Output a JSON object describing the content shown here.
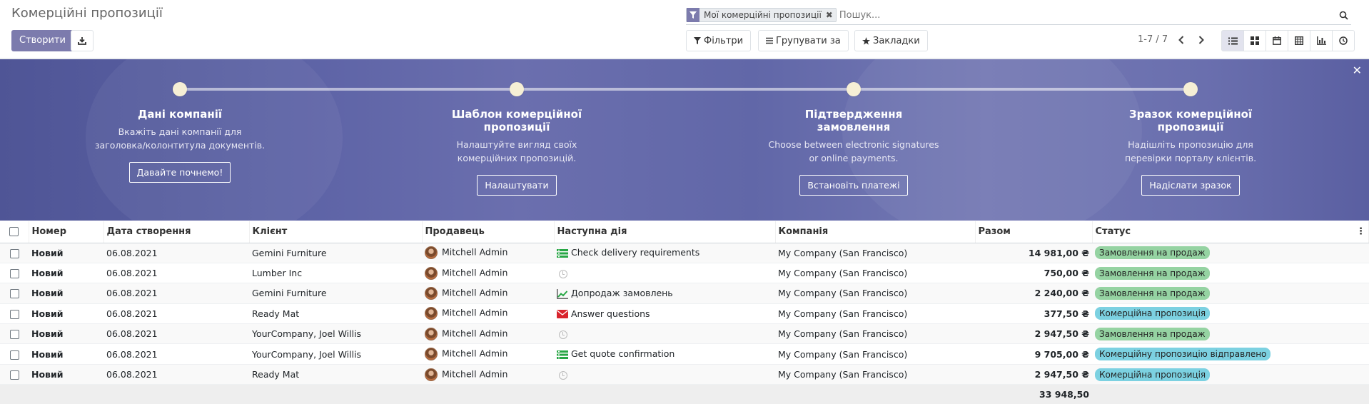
{
  "page": {
    "title": "Комерційні пропозиції"
  },
  "toolbar": {
    "create_label": "Створити",
    "download_icon": "download-icon"
  },
  "search": {
    "facet_label": "Мої комерційні пропозиції",
    "placeholder": "Пошук..."
  },
  "filters": {
    "filters_label": "Фільтри",
    "group_by_label": "Групувати за",
    "favorites_label": "Закладки"
  },
  "pager": {
    "value": "1-7 / 7"
  },
  "views": [
    "list",
    "kanban",
    "calendar",
    "pivot",
    "graph",
    "activity"
  ],
  "banner": {
    "steps": [
      {
        "title": "Дані компанії",
        "desc": "Вкажіть дані компанії для заголовка/колонтитула документів.",
        "button": "Давайте почнемо!"
      },
      {
        "title": "Шаблон комерційної пропозиції",
        "desc": "Налаштуйте вигляд своїх комерційних пропозицій.",
        "button": "Налаштувати"
      },
      {
        "title": "Підтвердження замовлення",
        "desc": "Choose between electronic signatures or online payments.",
        "button": "Встановіть платежі"
      },
      {
        "title": "Зразок комерційної пропозиції",
        "desc": "Надішліть пропозицію для перевірки порталу клієнтів.",
        "button": "Надіслати зразок"
      }
    ]
  },
  "table": {
    "columns": [
      "Номер",
      "Дата створення",
      "Клієнт",
      "Продавець",
      "Наступна дія",
      "Компанія",
      "Разом",
      "Статус"
    ],
    "rows": [
      {
        "number": "Новий",
        "date": "06.08.2021",
        "client": "Gemini Furniture",
        "salesperson": "Mitchell Admin",
        "activity_icon": "todo",
        "activity": "Check delivery requirements",
        "company": "My Company (San Francisco)",
        "total": "14 981,00 ₴",
        "status": "Замовлення на продаж",
        "status_type": "success"
      },
      {
        "number": "Новий",
        "date": "06.08.2021",
        "client": "Lumber Inc",
        "salesperson": "Mitchell Admin",
        "activity_icon": "clock",
        "activity": "",
        "company": "My Company (San Francisco)",
        "total": "750,00 ₴",
        "status": "Замовлення на продаж",
        "status_type": "success"
      },
      {
        "number": "Новий",
        "date": "06.08.2021",
        "client": "Gemini Furniture",
        "salesperson": "Mitchell Admin",
        "activity_icon": "upsell",
        "activity": "Допродаж замовлень",
        "company": "My Company (San Francisco)",
        "total": "2 240,00 ₴",
        "status": "Замовлення на продаж",
        "status_type": "success"
      },
      {
        "number": "Новий",
        "date": "06.08.2021",
        "client": "Ready Mat",
        "salesperson": "Mitchell Admin",
        "activity_icon": "email",
        "activity": "Answer questions",
        "company": "My Company (San Francisco)",
        "total": "377,50 ₴",
        "status": "Комерційна пропозиція",
        "status_type": "info"
      },
      {
        "number": "Новий",
        "date": "06.08.2021",
        "client": "YourCompany, Joel Willis",
        "salesperson": "Mitchell Admin",
        "activity_icon": "clock",
        "activity": "",
        "company": "My Company (San Francisco)",
        "total": "2 947,50 ₴",
        "status": "Замовлення на продаж",
        "status_type": "success"
      },
      {
        "number": "Новий",
        "date": "06.08.2021",
        "client": "YourCompany, Joel Willis",
        "salesperson": "Mitchell Admin",
        "activity_icon": "todo",
        "activity": "Get quote confirmation",
        "company": "My Company (San Francisco)",
        "total": "9 705,00 ₴",
        "status": "Комерційну пропозицію відправлено",
        "status_type": "info"
      },
      {
        "number": "Новий",
        "date": "06.08.2021",
        "client": "Ready Mat",
        "salesperson": "Mitchell Admin",
        "activity_icon": "clock",
        "activity": "",
        "company": "My Company (San Francisco)",
        "total": "2 947,50 ₴",
        "status": "Комерційна пропозиція",
        "status_type": "info"
      }
    ],
    "footer_total": "33 948,50"
  },
  "colors": {
    "primary": "#7c7bad",
    "success_badge": "#95d3a2",
    "info_badge": "#7cd1e1",
    "email_icon": "#d9242d",
    "todo_icon": "#28a745"
  }
}
